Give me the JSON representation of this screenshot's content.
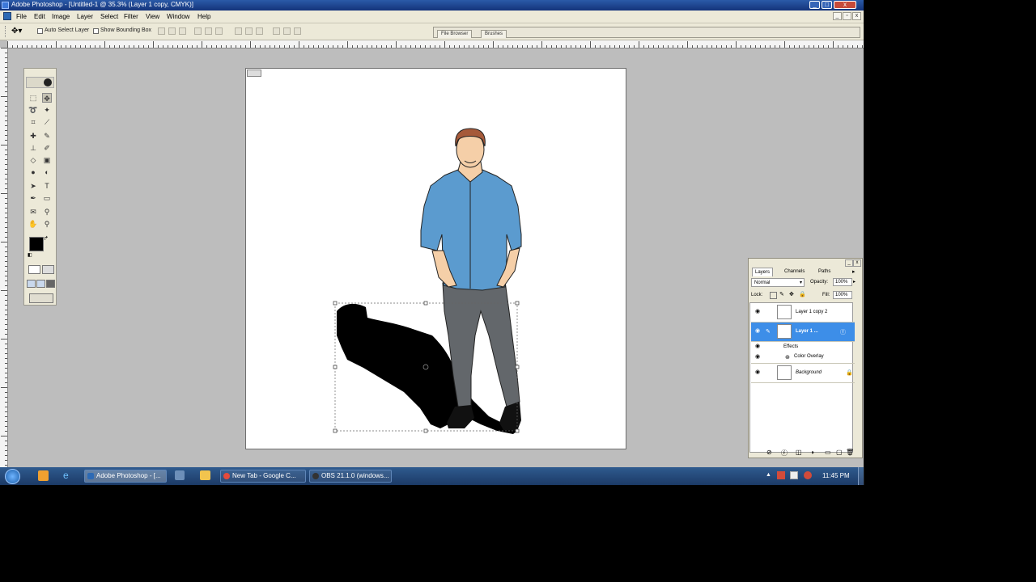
{
  "window": {
    "title": "Adobe Photoshop - [Untitled-1 @ 35.3% (Layer 1 copy, CMYK)]",
    "controls": [
      "_",
      "□",
      "x"
    ]
  },
  "menu": [
    "File",
    "Edit",
    "Image",
    "Layer",
    "Select",
    "Filter",
    "View",
    "Window",
    "Help"
  ],
  "options": {
    "auto_select_layer": "Auto Select Layer",
    "show_bounding_box": "Show Bounding Box"
  },
  "palette_well": {
    "tabs": [
      "File Browser",
      "Brushes"
    ]
  },
  "layers_panel": {
    "tabs": [
      "Layers",
      "Channels",
      "Paths"
    ],
    "blend_mode": "Normal",
    "opacity_label": "Opacity:",
    "opacity_value": "100%",
    "lock_label": "Lock:",
    "fill_label": "Fill:",
    "fill_value": "100%",
    "layers": [
      {
        "name": "Layer 1 copy 2",
        "selected": false
      },
      {
        "name": "Layer 1 ...",
        "selected": true
      },
      {
        "name": "Effects",
        "selected": false
      },
      {
        "name": "Color Overlay",
        "selected": false
      },
      {
        "name": "Background",
        "selected": false
      }
    ]
  },
  "taskbar": {
    "buttons": [
      "Adobe Photoshop - [...",
      "New Tab - Google C...",
      "OBS 21.1.0 (windows..."
    ],
    "clock": "11:45 PM"
  },
  "colors": {
    "shirt": "#5b9bcf",
    "pants": "#63676b",
    "skin": "#f5cfa8",
    "hair": "#a65a3a",
    "selection": "#3d8ee8"
  }
}
